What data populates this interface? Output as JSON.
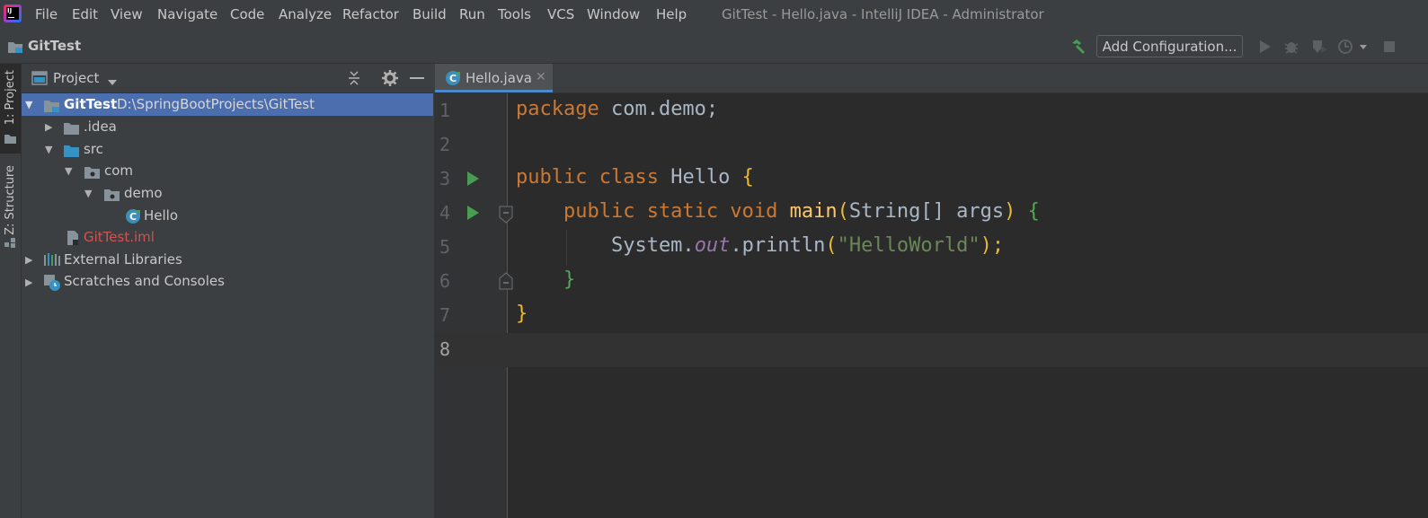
{
  "menu": {
    "items": [
      "File",
      "Edit",
      "View",
      "Navigate",
      "Code",
      "Analyze",
      "Refactor",
      "Build",
      "Run",
      "Tools",
      "VCS",
      "Window",
      "Help"
    ]
  },
  "window_title": "GitTest - Hello.java - IntelliJ IDEA - Administrator",
  "navbar": {
    "project": "GitTest",
    "add_configuration": "Add Configuration..."
  },
  "side_tabs": {
    "project": "1: Project",
    "structure": "Z: Structure"
  },
  "project_panel": {
    "title": "Project",
    "tree": [
      {
        "label": "GitTest",
        "path": "D:\\SpringBootProjects\\GitTest"
      },
      {
        "label": ".idea"
      },
      {
        "label": "src"
      },
      {
        "label": "com"
      },
      {
        "label": "demo"
      },
      {
        "label": "Hello"
      },
      {
        "label": "GitTest.iml"
      },
      {
        "label": "External Libraries"
      },
      {
        "label": "Scratches and Consoles"
      }
    ]
  },
  "editor": {
    "tab": "Hello.java",
    "line_numbers": [
      "1",
      "2",
      "3",
      "4",
      "5",
      "6",
      "7",
      "8"
    ],
    "code": {
      "l1_kw": "package",
      "l1_rest": " com.demo;",
      "l3_kw": "public class",
      "l3_name": " Hello ",
      "l3_brace": "{",
      "l4_kw": "    public static void",
      "l4_fn": " main",
      "l4_p1": "(",
      "l4_args": "String[] args",
      "l4_p2": ") ",
      "l4_brace": "{",
      "l5_a": "        System.",
      "l5_field": "out",
      "l5_b": ".println",
      "l5_p1": "(",
      "l5_str": "\"HelloWorld\"",
      "l5_p2": ");",
      "l6_brace": "    }",
      "l7_brace": "}"
    }
  },
  "colors": {
    "keyword": "#cc7832",
    "string": "#6a8759",
    "field": "#9876aa",
    "function": "#ffc66d",
    "selection": "#4b6eaf",
    "iml_file": "#d25252"
  }
}
